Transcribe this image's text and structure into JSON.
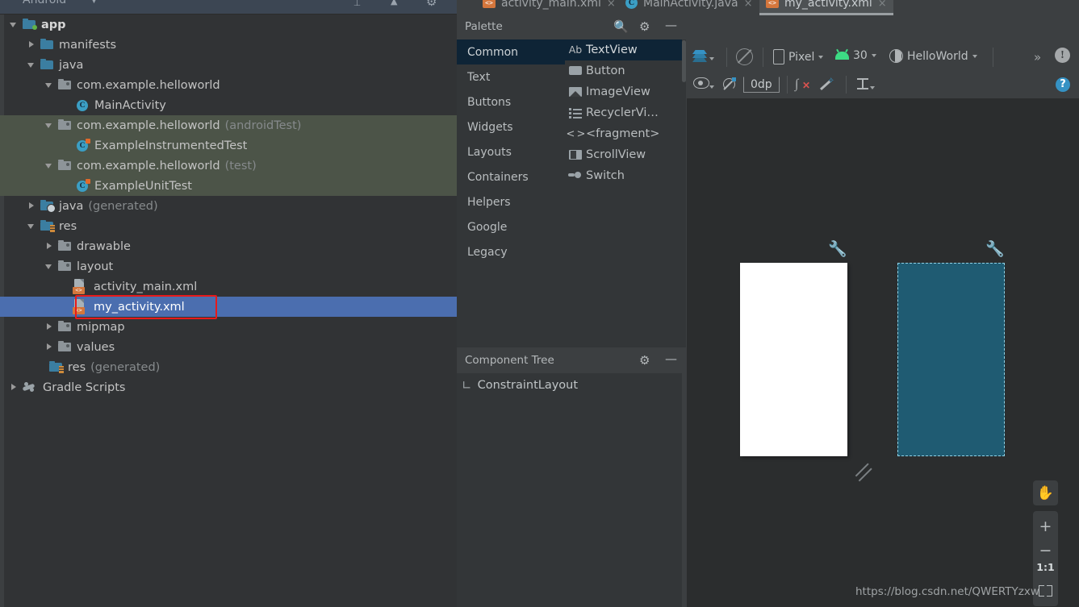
{
  "project": {
    "header_title": "Android",
    "header_icons": [
      "split-view-icon",
      "collapse-all-icon",
      "settings-gear-icon"
    ],
    "tree": [
      {
        "indent": 0,
        "arrow": "down",
        "icon": "folder-module",
        "label": "app",
        "style": "bold",
        "suffix": ""
      },
      {
        "indent": 1,
        "arrow": "right",
        "icon": "folder-blue",
        "label": "manifests",
        "style": "normal",
        "suffix": ""
      },
      {
        "indent": 1,
        "arrow": "down",
        "icon": "folder-blue",
        "label": "java",
        "style": "normal",
        "suffix": ""
      },
      {
        "indent": 2,
        "arrow": "down",
        "icon": "folder-package",
        "label": "com.example.helloworld",
        "style": "normal",
        "suffix": ""
      },
      {
        "indent": 3,
        "arrow": "none",
        "icon": "java-class",
        "label": "MainActivity",
        "style": "normal",
        "suffix": ""
      },
      {
        "indent": 2,
        "arrow": "down",
        "icon": "folder-package",
        "label": "com.example.helloworld",
        "style": "normal",
        "suffix": "(androidTest)",
        "highlight": "green"
      },
      {
        "indent": 3,
        "arrow": "none",
        "icon": "java-test-class",
        "label": "ExampleInstrumentedTest",
        "style": "normal",
        "suffix": "",
        "highlight": "green"
      },
      {
        "indent": 2,
        "arrow": "down",
        "icon": "folder-package",
        "label": "com.example.helloworld",
        "style": "normal",
        "suffix": "(test)",
        "highlight": "green"
      },
      {
        "indent": 3,
        "arrow": "none",
        "icon": "java-test-class",
        "label": "ExampleUnitTest",
        "style": "normal",
        "suffix": "",
        "highlight": "green"
      },
      {
        "indent": 1,
        "arrow": "right",
        "icon": "folder-generated",
        "label": "java",
        "style": "normal",
        "suffix": "(generated)"
      },
      {
        "indent": 1,
        "arrow": "down",
        "icon": "folder-res",
        "label": "res",
        "style": "normal",
        "suffix": ""
      },
      {
        "indent": 2,
        "arrow": "right",
        "icon": "folder-package",
        "label": "drawable",
        "style": "normal",
        "suffix": ""
      },
      {
        "indent": 2,
        "arrow": "down",
        "icon": "folder-package",
        "label": "layout",
        "style": "normal",
        "suffix": ""
      },
      {
        "indent": 3,
        "arrow": "none",
        "icon": "xml-layout-file",
        "label": "activity_main.xml",
        "style": "normal",
        "suffix": ""
      },
      {
        "indent": 3,
        "arrow": "none",
        "icon": "xml-layout-file",
        "label": "my_activity.xml",
        "style": "normal",
        "suffix": "",
        "highlight": "selected"
      },
      {
        "indent": 2,
        "arrow": "right",
        "icon": "folder-package",
        "label": "mipmap",
        "style": "normal",
        "suffix": ""
      },
      {
        "indent": 2,
        "arrow": "right",
        "icon": "folder-package",
        "label": "values",
        "style": "normal",
        "suffix": ""
      },
      {
        "indent": 1,
        "arrow": "none",
        "icon": "folder-res",
        "label": "res",
        "style": "normal",
        "suffix": "(generated)"
      },
      {
        "indent": 0,
        "arrow": "right",
        "icon": "gradle",
        "label": "Gradle Scripts",
        "style": "normal",
        "suffix": ""
      }
    ]
  },
  "editor_tabs": [
    {
      "label": "activity_main.xml",
      "icon": "xml-file-icon",
      "active": false,
      "close": "×"
    },
    {
      "label": "MainActivity.java",
      "icon": "java-file-icon",
      "active": false,
      "close": "×"
    },
    {
      "label": "my_activity.xml",
      "icon": "xml-file-icon",
      "active": true,
      "close": "×"
    }
  ],
  "palette": {
    "title": "Palette",
    "header_icons": [
      "search-icon",
      "settings-gear-icon",
      "minimize-icon"
    ],
    "groups": [
      "Common",
      "Text",
      "Buttons",
      "Widgets",
      "Layouts",
      "Containers",
      "Helpers",
      "Google",
      "Legacy"
    ],
    "selected_group": "Common",
    "items": [
      {
        "label": "TextView",
        "icon": "ab-text-icon",
        "selected": true
      },
      {
        "label": "Button",
        "icon": "button-icon",
        "selected": false
      },
      {
        "label": "ImageView",
        "icon": "image-icon",
        "selected": false
      },
      {
        "label": "RecyclerVi…",
        "icon": "list-icon",
        "selected": false
      },
      {
        "label": "<fragment>",
        "icon": "code-brackets-icon",
        "selected": false
      },
      {
        "label": "ScrollView",
        "icon": "scroll-icon",
        "selected": false
      },
      {
        "label": "Switch",
        "icon": "switch-icon",
        "selected": false
      }
    ]
  },
  "component_tree": {
    "title": "Component Tree",
    "header_icons": [
      "settings-gear-icon",
      "minimize-icon"
    ],
    "root_node": "ConstraintLayout",
    "root_icon": "constraint-layout-icon"
  },
  "design_toolbar": {
    "mode_icon": "design-mode-layers-icon",
    "orientation_icon": "rotate-device-icon",
    "device": "Pixel",
    "device_icon": "phone-icon",
    "api_level": "30",
    "api_icon": "android-icon",
    "theme": "HelloWorld",
    "theme_icon": "theme-contrast-icon",
    "overflow": "»",
    "issues_icon": "warning-issue-icon"
  },
  "constraint_toolbar": {
    "view_options_icon": "eye-icon",
    "autoconnect_icon": "magnet-off-icon",
    "default_margin": "0dp",
    "clear_constraints_icon": "clear-constraints-icon",
    "infer_constraints_icon": "magic-wand-icon",
    "baseline_icon": "baseline-align-icon",
    "help_icon": "help-question-icon"
  },
  "canvas": {
    "design_surface_bg": "#2b2d2e",
    "device_design_bg": "#ffffff",
    "device_blueprint_bg": "#1f5b72",
    "blueprint_border": "#8fd3e8",
    "wrench_icon": "render-settings-wrench-icon",
    "resize_handle_icon": "resize-handle-icon"
  },
  "zoom_controls": {
    "pan_icon": "pan-hand-icon",
    "zoom_in": "+",
    "zoom_out": "−",
    "zoom_level": "1:1",
    "zoom_fit_icon": "zoom-to-fit-icon"
  },
  "watermark": "https://blog.csdn.net/QWERTYzxw",
  "colors": {
    "selection_blue": "#4b6eaf",
    "test_folder_green": "#4c5448",
    "annotation_red": "#e81a1a",
    "accent_blue": "#3592c4",
    "android_green": "#3ddc84"
  }
}
